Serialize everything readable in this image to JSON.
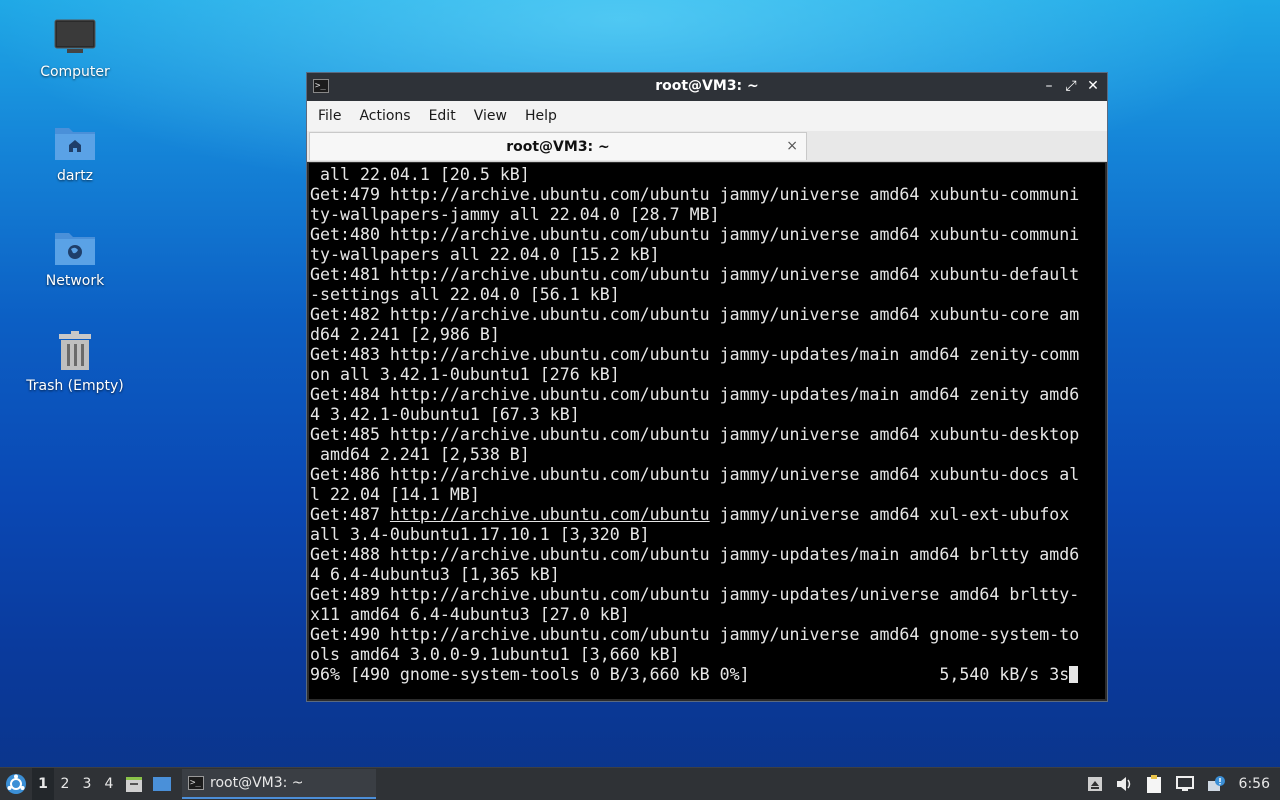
{
  "desktop": {
    "icons": [
      {
        "label": "Computer"
      },
      {
        "label": "dartz"
      },
      {
        "label": "Network"
      },
      {
        "label": "Trash (Empty)"
      }
    ]
  },
  "window": {
    "title": "root@VM3: ~",
    "menu": [
      "File",
      "Actions",
      "Edit",
      "View",
      "Help"
    ],
    "tab_label": "root@VM3: ~",
    "tab_close": "×",
    "terminal_lines": [
      " all 22.04.1 [20.5 kB]",
      "Get:479 http://archive.ubuntu.com/ubuntu jammy/universe amd64 xubuntu-communi",
      "ty-wallpapers-jammy all 22.04.0 [28.7 MB]",
      "Get:480 http://archive.ubuntu.com/ubuntu jammy/universe amd64 xubuntu-communi",
      "ty-wallpapers all 22.04.0 [15.2 kB]",
      "Get:481 http://archive.ubuntu.com/ubuntu jammy/universe amd64 xubuntu-default",
      "-settings all 22.04.0 [56.1 kB]",
      "Get:482 http://archive.ubuntu.com/ubuntu jammy/universe amd64 xubuntu-core am",
      "d64 2.241 [2,986 B]",
      "Get:483 http://archive.ubuntu.com/ubuntu jammy-updates/main amd64 zenity-comm",
      "on all 3.42.1-0ubuntu1 [276 kB]",
      "Get:484 http://archive.ubuntu.com/ubuntu jammy-updates/main amd64 zenity amd6",
      "4 3.42.1-0ubuntu1 [67.3 kB]",
      "Get:485 http://archive.ubuntu.com/ubuntu jammy/universe amd64 xubuntu-desktop",
      " amd64 2.241 [2,538 B]",
      "Get:486 http://archive.ubuntu.com/ubuntu jammy/universe amd64 xubuntu-docs al",
      "l 22.04 [14.1 MB]",
      {
        "prefix": "Get:487 ",
        "link": "http://archive.ubuntu.com/ubuntu",
        "suffix": " jammy/universe amd64 xul-ext-ubufox"
      },
      "all 3.4-0ubuntu1.17.10.1 [3,320 B]",
      "Get:488 http://archive.ubuntu.com/ubuntu jammy-updates/main amd64 brltty amd6",
      "4 6.4-4ubuntu3 [1,365 kB]",
      "Get:489 http://archive.ubuntu.com/ubuntu jammy-updates/universe amd64 brltty-",
      "x11 amd64 6.4-4ubuntu3 [27.0 kB]",
      "Get:490 http://archive.ubuntu.com/ubuntu jammy/universe amd64 gnome-system-to",
      "ols amd64 3.0.0-9.1ubuntu1 [3,660 kB]",
      "96% [490 gnome-system-tools 0 B/3,660 kB 0%]                   5,540 kB/s 3s"
    ]
  },
  "taskbar": {
    "workspaces": [
      "1",
      "2",
      "3",
      "4"
    ],
    "active_workspace": "1",
    "task_label": "root@VM3: ~",
    "clock": "6:56"
  }
}
